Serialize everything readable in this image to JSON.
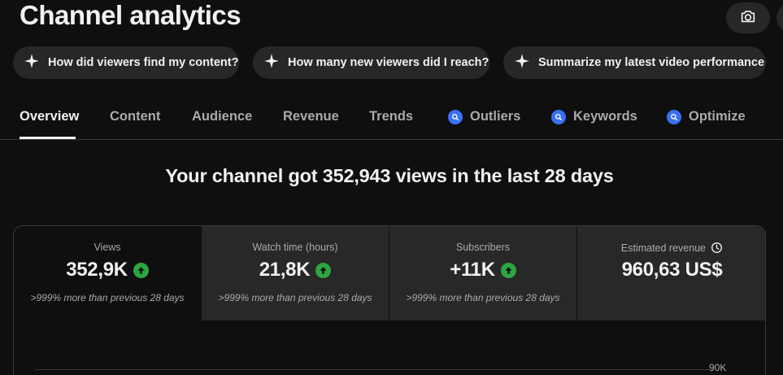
{
  "page": {
    "title": "Channel analytics"
  },
  "header_actions": {
    "camera_icon": "camera-icon",
    "more_icon": "more-icon"
  },
  "chips": [
    {
      "label": "How did viewers find my content?",
      "icon": "sparkle-icon"
    },
    {
      "label": "How many new viewers did I reach?",
      "icon": "sparkle-icon"
    },
    {
      "label": "Summarize my latest video performance",
      "icon": "sparkle-icon"
    }
  ],
  "tabs": [
    {
      "label": "Overview",
      "active": true
    },
    {
      "label": "Content"
    },
    {
      "label": "Audience"
    },
    {
      "label": "Revenue"
    },
    {
      "label": "Trends"
    },
    {
      "label": "Outliers",
      "badge_icon": "tool-badge-icon"
    },
    {
      "label": "Keywords",
      "badge_icon": "tool-badge-icon"
    },
    {
      "label": "Optimize",
      "badge_icon": "tool-badge-icon"
    }
  ],
  "headline": "Your channel got 352,943 views in the last 28 days",
  "metrics": [
    {
      "label": "Views",
      "value": "352,9K",
      "trend": "up",
      "note": ">999% more than previous 28 days",
      "selected": true
    },
    {
      "label": "Watch time (hours)",
      "value": "21,8K",
      "trend": "up",
      "note": ">999% more than previous 28 days"
    },
    {
      "label": "Subscribers",
      "value": "+11K",
      "trend": "up",
      "note": ">999% more than previous 28 days"
    },
    {
      "label": "Estimated revenue",
      "value": "960,63 US$",
      "info_icon": "clock-icon"
    }
  ],
  "chart": {
    "y_tick_label": "90K"
  },
  "colors": {
    "background": "#0f0f0f",
    "chip_bg": "#272727",
    "trend_up": "#2ba640",
    "badge_blue": "#3a6ff7"
  }
}
